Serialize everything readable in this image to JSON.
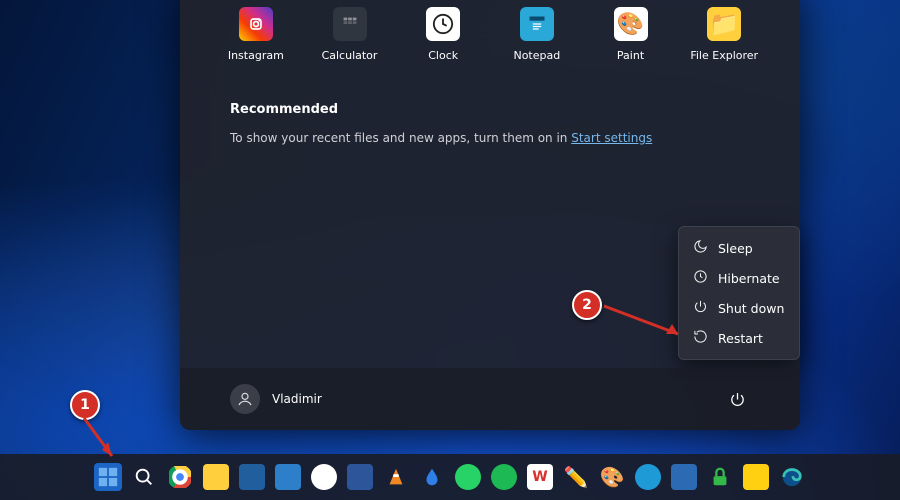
{
  "pinned_apps": [
    {
      "name": "instagram",
      "label": "Instagram",
      "bg": "linear-gradient(45deg,#fdbd01 5%,#f73b04 35%,#cd2e8d 65%,#5d3cc1 95%)",
      "glyph": "◯"
    },
    {
      "name": "calculator",
      "label": "Calculator",
      "bg": "#2f3640",
      "glyph": "⊞"
    },
    {
      "name": "clock",
      "label": "Clock",
      "bg": "#fff",
      "glyph": "clock"
    },
    {
      "name": "notepad",
      "label": "Notepad",
      "bg": "#2aa8d8",
      "glyph": "≣"
    },
    {
      "name": "paint",
      "label": "Paint",
      "bg": "#fff",
      "glyph": "🎨"
    },
    {
      "name": "file-explorer",
      "label": "File Explorer",
      "bg": "#ffcf3d",
      "glyph": "📁"
    }
  ],
  "recommended": {
    "heading": "Recommended",
    "text_before": "To show your recent files and new apps, turn them on in ",
    "link": "Start settings"
  },
  "user": {
    "name": "Vladimir"
  },
  "power_menu": [
    {
      "name": "sleep",
      "label": "Sleep",
      "icon": "moon"
    },
    {
      "name": "hibernate",
      "label": "Hibernate",
      "icon": "clock"
    },
    {
      "name": "shutdown",
      "label": "Shut down",
      "icon": "power"
    },
    {
      "name": "restart",
      "label": "Restart",
      "icon": "refresh"
    }
  ],
  "taskbar": [
    {
      "name": "start",
      "type": "start"
    },
    {
      "name": "search",
      "type": "search"
    },
    {
      "name": "chrome",
      "color": "#fff",
      "inner": "chrome"
    },
    {
      "name": "file-explorer",
      "color": "#ffcf3d"
    },
    {
      "name": "calculator",
      "color": "#205e9e"
    },
    {
      "name": "notes",
      "color": "#2c7fc8"
    },
    {
      "name": "messenger",
      "color": "#fff",
      "inner": "circle-blue"
    },
    {
      "name": "word",
      "color": "#2c5699"
    },
    {
      "name": "vlc",
      "color": "#f08923",
      "inner": "triangle"
    },
    {
      "name": "waterdrop",
      "color": "#0d1320",
      "inner": "drop"
    },
    {
      "name": "whatsapp",
      "color": "#27d366",
      "inner": "circle-white"
    },
    {
      "name": "spotify",
      "color": "#1db954",
      "inner": "circle"
    },
    {
      "name": "wps",
      "color": "#fff",
      "inner": "w-red"
    },
    {
      "name": "pencil",
      "color": "transparent",
      "inner": "pencil"
    },
    {
      "name": "paint",
      "color": "transparent",
      "inner": "palette"
    },
    {
      "name": "comment",
      "color": "#1e9bd7",
      "inner": "circle"
    },
    {
      "name": "app-blue",
      "color": "#2c6ab3"
    },
    {
      "name": "lock",
      "color": "#35b84a",
      "inner": "lock"
    },
    {
      "name": "app-yellow",
      "color": "#ffcf11"
    },
    {
      "name": "edge",
      "color": "#0d1320",
      "inner": "edge"
    }
  ],
  "callouts": {
    "one": "1",
    "two": "2"
  }
}
